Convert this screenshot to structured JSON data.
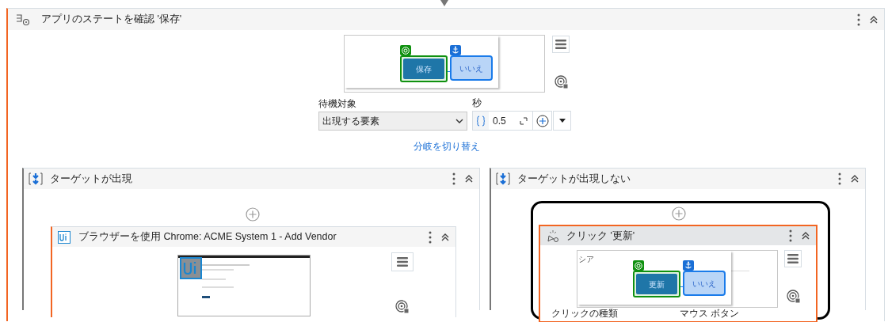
{
  "activity": {
    "title": "アプリのステートを確認 '保存'",
    "preview": {
      "target_label": "保存",
      "anchor_label": "いいえ"
    },
    "wait_for": {
      "label": "待機対象",
      "value": "出現する要素"
    },
    "seconds": {
      "label": "秒",
      "value": "0.5"
    },
    "switch_link": "分岐を切り替え"
  },
  "branches": [
    {
      "title": "ターゲットが出現",
      "child": {
        "kind": "browser",
        "title": "ブラウザーを使用 Chrome: ACME System 1 - Add Vendor",
        "selected": false
      }
    },
    {
      "title": "ターゲットが出現しない",
      "child": {
        "kind": "click",
        "title": "クリック '更新'",
        "selected": true,
        "preview": {
          "corner_text": "シア",
          "target_label": "更新",
          "anchor_label": "いいえ"
        },
        "fields": [
          "クリックの種類",
          "マウス ボタン"
        ]
      }
    }
  ]
}
